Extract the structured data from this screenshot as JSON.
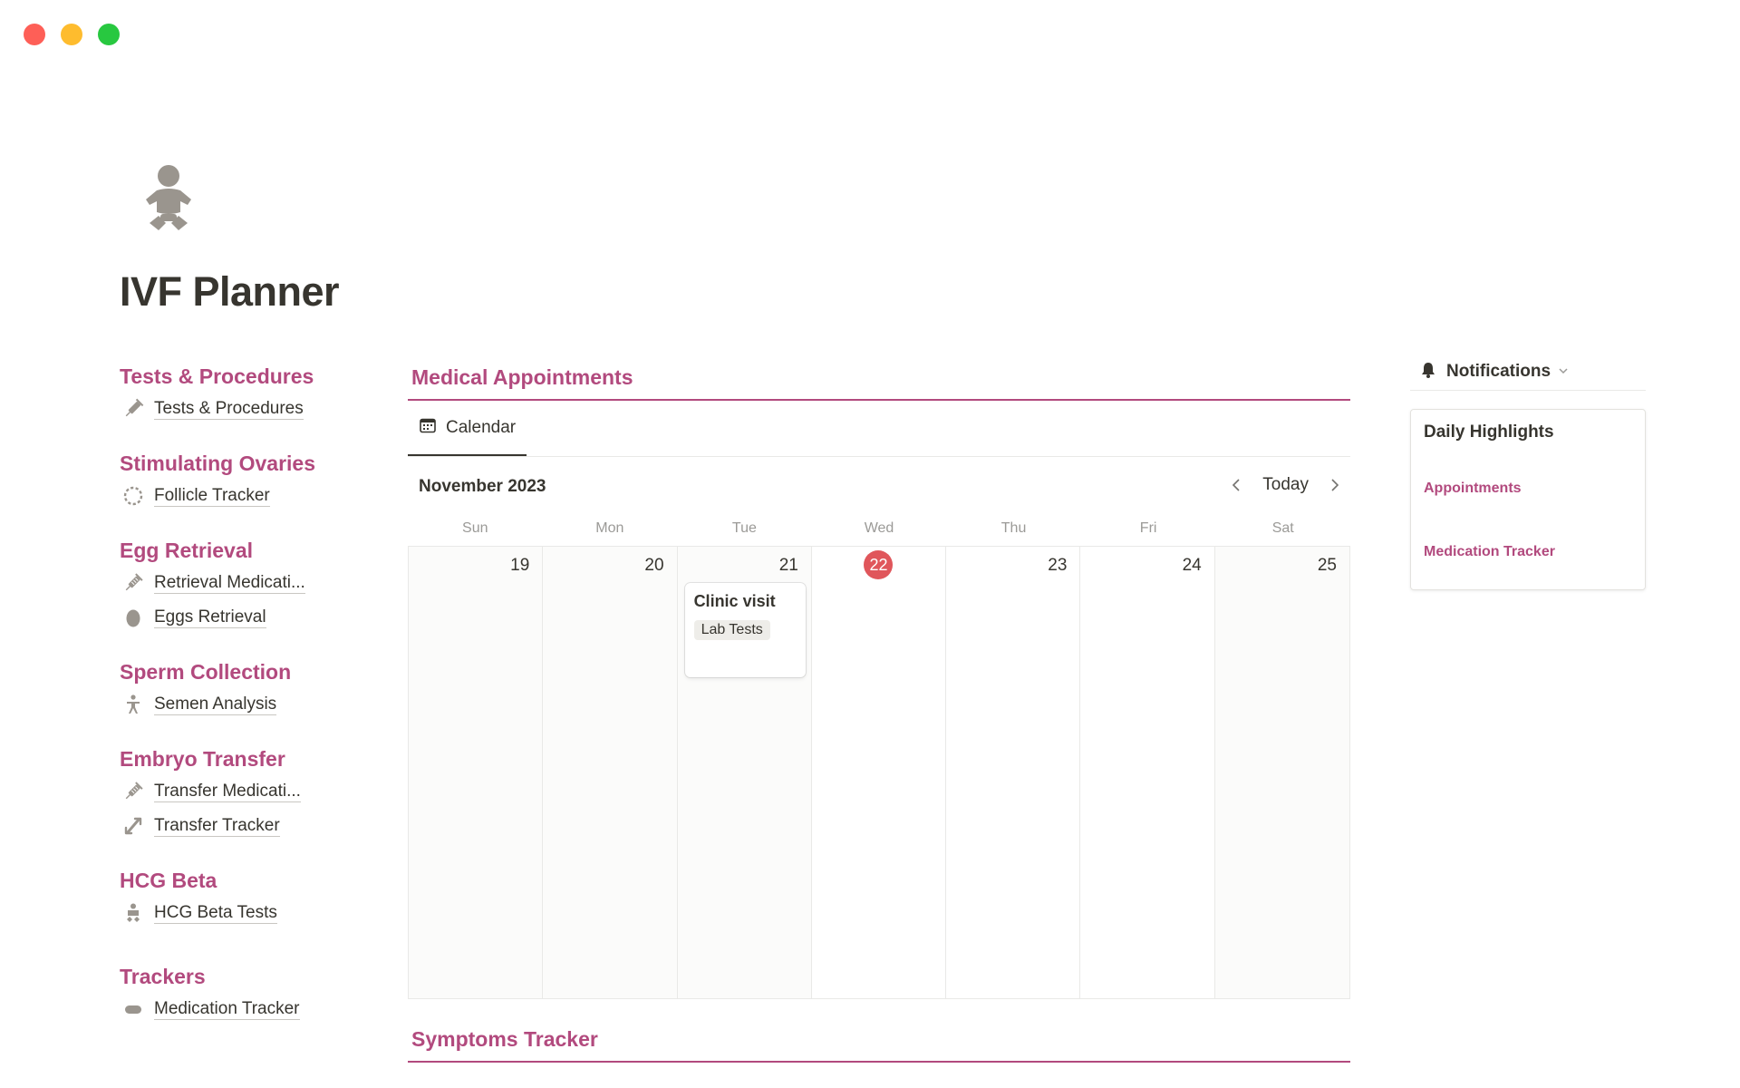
{
  "window": {
    "controls": [
      "close",
      "minimize",
      "zoom"
    ]
  },
  "page": {
    "title": "IVF Planner",
    "icon": "baby-icon"
  },
  "sidebar": {
    "sections": [
      {
        "heading": "Tests & Procedures",
        "links": [
          {
            "label": "Tests & Procedures",
            "icon": "syringe-icon"
          }
        ]
      },
      {
        "heading": "Stimulating Ovaries",
        "links": [
          {
            "label": "Follicle Tracker",
            "icon": "dashed-circle-icon"
          }
        ]
      },
      {
        "heading": "Egg Retrieval",
        "links": [
          {
            "label": "Retrieval Medicati...",
            "icon": "syringe-icon"
          },
          {
            "label": "Eggs Retrieval",
            "icon": "egg-icon"
          }
        ]
      },
      {
        "heading": "Sperm Collection",
        "links": [
          {
            "label": "Semen Analysis",
            "icon": "person-icon"
          }
        ]
      },
      {
        "heading": "Embryo Transfer",
        "links": [
          {
            "label": "Transfer Medicati...",
            "icon": "syringe-icon"
          },
          {
            "label": "Transfer Tracker",
            "icon": "transfer-icon"
          }
        ]
      },
      {
        "heading": "HCG Beta",
        "links": [
          {
            "label": "HCG Beta Tests",
            "icon": "baby-icon"
          }
        ]
      },
      {
        "heading": "Trackers",
        "links": [
          {
            "label": "Medication Tracker",
            "icon": "pill-icon"
          }
        ]
      }
    ]
  },
  "appointments": {
    "title": "Medical Appointments",
    "view_tab": "Calendar",
    "month": "November 2023",
    "today_label": "Today",
    "weekdays": [
      "Sun",
      "Mon",
      "Tue",
      "Wed",
      "Thu",
      "Fri",
      "Sat"
    ],
    "days": [
      "19",
      "20",
      "21",
      "22",
      "23",
      "24",
      "25"
    ],
    "today_index": 3,
    "event": {
      "title": "Clinic visit",
      "tag": "Lab Tests",
      "day": "21"
    }
  },
  "symptoms": {
    "title": "Symptoms Tracker"
  },
  "notifications": {
    "label": "Notifications"
  },
  "highlights": {
    "title": "Daily Highlights",
    "links": [
      "Appointments",
      "Medication Tracker"
    ]
  },
  "colors": {
    "accent": "#b24a7e",
    "today": "#e0565b",
    "icon_gray": "#9a958e"
  }
}
